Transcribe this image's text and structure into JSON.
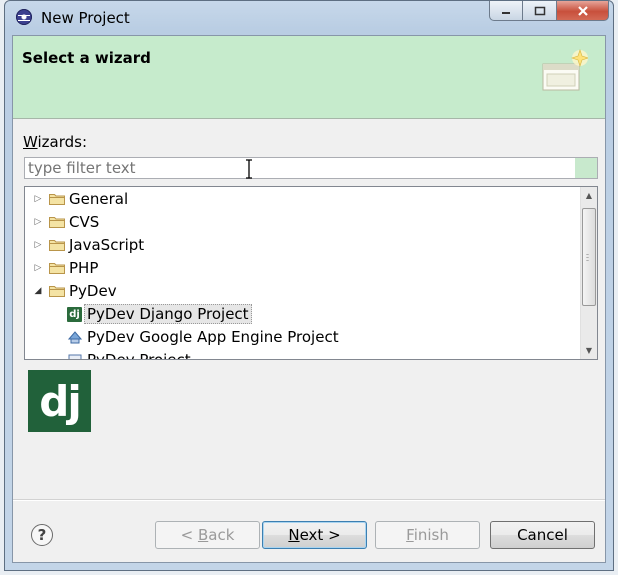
{
  "window": {
    "title": "New Project",
    "controls": {
      "minimize_icon": "minimize-icon",
      "maximize_icon": "maximize-icon",
      "close_icon": "close-icon"
    }
  },
  "banner": {
    "title": "Select a wizard",
    "icon": "wizard-banner-icon",
    "color": "#c6ebcc"
  },
  "wizards": {
    "label_prefix": "W",
    "label_rest": "izards:",
    "filter_placeholder": "type filter text",
    "filter_value": "",
    "tree": [
      {
        "label": "General",
        "icon": "folder-icon",
        "expanded": false
      },
      {
        "label": "CVS",
        "icon": "folder-icon",
        "expanded": false
      },
      {
        "label": "JavaScript",
        "icon": "folder-icon",
        "expanded": false
      },
      {
        "label": "PHP",
        "icon": "folder-icon",
        "expanded": false
      },
      {
        "label": "PyDev",
        "icon": "folder-icon",
        "expanded": true,
        "children": [
          {
            "label": "PyDev Django Project",
            "icon": "django-icon",
            "selected": true
          },
          {
            "label": "PyDev Google App Engine Project",
            "icon": "google-app-engine-icon"
          },
          {
            "label": "PyDev Project",
            "icon": "pydev-icon"
          }
        ]
      }
    ]
  },
  "preview": {
    "logo_text": "dj",
    "color": "#21613a"
  },
  "buttons": {
    "back": {
      "mnemonic": "B",
      "pre": "< ",
      "rest": "ack"
    },
    "next": {
      "mnemonic": "N",
      "rest": "ext >"
    },
    "finish": {
      "mnemonic": "F",
      "rest": "inish"
    },
    "cancel": "Cancel",
    "help_symbol": "?"
  }
}
